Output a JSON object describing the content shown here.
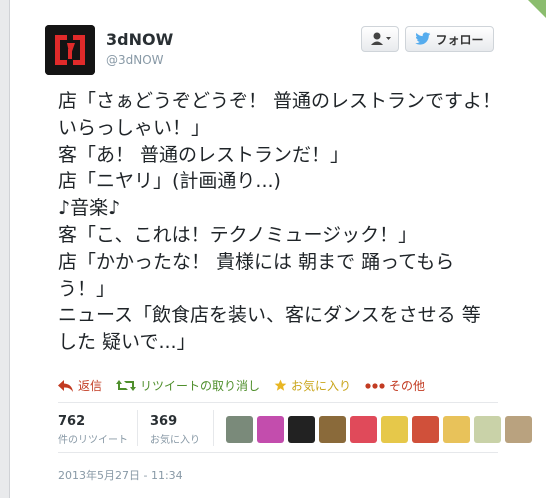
{
  "header": {
    "display_name": "3dNOW",
    "username": "@3dNOW",
    "follow_label": "フォロー"
  },
  "tweet": {
    "lines": [
      "店「さぁどうぞどうぞ！ 普通のレストランですよ！",
      "いらっしゃい！」",
      "客「あ！ 普通のレストランだ！」",
      "店「ニヤリ」(計画通り...)",
      "♪音楽♪",
      "客「こ、これは！テクノミュージック！」",
      "店「かかったな！ 貴様には 朝まで 踊ってもら",
      "う！」",
      "ニュース「飲食店を装い、客にダンスをさせる 等",
      "した 疑いで...」"
    ]
  },
  "actions": {
    "reply": "返信",
    "retweet": "リツイートの取り消し",
    "favorite": "お気に入り",
    "more": "その他"
  },
  "stats": {
    "retweets_count": "762",
    "retweets_label": "件のリツイート",
    "favorites_count": "369",
    "favorites_label": "お気に入り"
  },
  "engagers": {
    "avatar_colors": [
      "#7a8a7a",
      "#c34dad",
      "#222222",
      "#8a6a3a",
      "#e04a5a",
      "#e6c84a",
      "#d0503a",
      "#e8c25a",
      "#c9d2a8",
      "#b9a27f"
    ]
  },
  "timestamp": "2013年5月27日 - 11:34",
  "colors": {
    "reply_red": "#c23b22",
    "retweet_green": "#4f8f2c",
    "favorite_gold": "#c9a51a",
    "twitter_blue": "#55acee"
  }
}
